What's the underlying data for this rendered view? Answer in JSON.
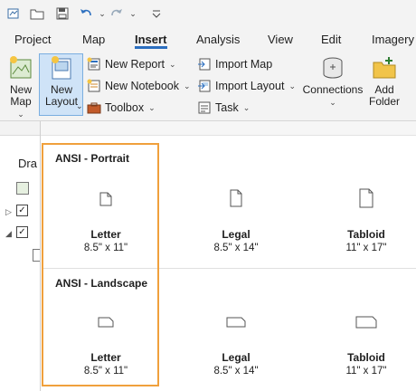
{
  "quick_access": {
    "icons": [
      "project-icon",
      "open-icon",
      "save-icon",
      "undo-icon",
      "redo-icon",
      "customize-icon"
    ]
  },
  "tabs": [
    {
      "label": "Project"
    },
    {
      "label": "Map"
    },
    {
      "label": "Insert"
    },
    {
      "label": "Analysis"
    },
    {
      "label": "View"
    },
    {
      "label": "Edit"
    },
    {
      "label": "Imagery"
    }
  ],
  "active_tab": "Insert",
  "ribbon": {
    "new_map": {
      "line1": "New",
      "line2": "Map"
    },
    "new_layout": {
      "line1": "New",
      "line2": "Layout"
    },
    "new_report": "New Report",
    "new_notebook": "New Notebook",
    "toolbox": "Toolbox",
    "import_map": "Import Map",
    "import_layout": "Import Layout",
    "task": "Task",
    "connections": "Connections",
    "add_folder": {
      "line1": "Add",
      "line2": "Folder"
    }
  },
  "left_pane": {
    "title_partial": "Dra"
  },
  "layout_gallery": {
    "sections": [
      {
        "title": "ANSI - Portrait",
        "orientation": "portrait",
        "items": [
          {
            "name": "Letter",
            "size": "8.5\" x 11\""
          },
          {
            "name": "Legal",
            "size": "8.5\" x 14\""
          },
          {
            "name": "Tabloid",
            "size": "11\" x 17\""
          }
        ]
      },
      {
        "title": "ANSI - Landscape",
        "orientation": "landscape",
        "items": [
          {
            "name": "Letter",
            "size": "8.5\" x 11\""
          },
          {
            "name": "Legal",
            "size": "8.5\" x 14\""
          },
          {
            "name": "Tabloid",
            "size": "11\" x 17\""
          }
        ]
      }
    ]
  },
  "colors": {
    "highlight_border": "#f0a03c",
    "active_tab_underline": "#2c6fbf",
    "ribbon_bg": "#f3f3f3"
  }
}
